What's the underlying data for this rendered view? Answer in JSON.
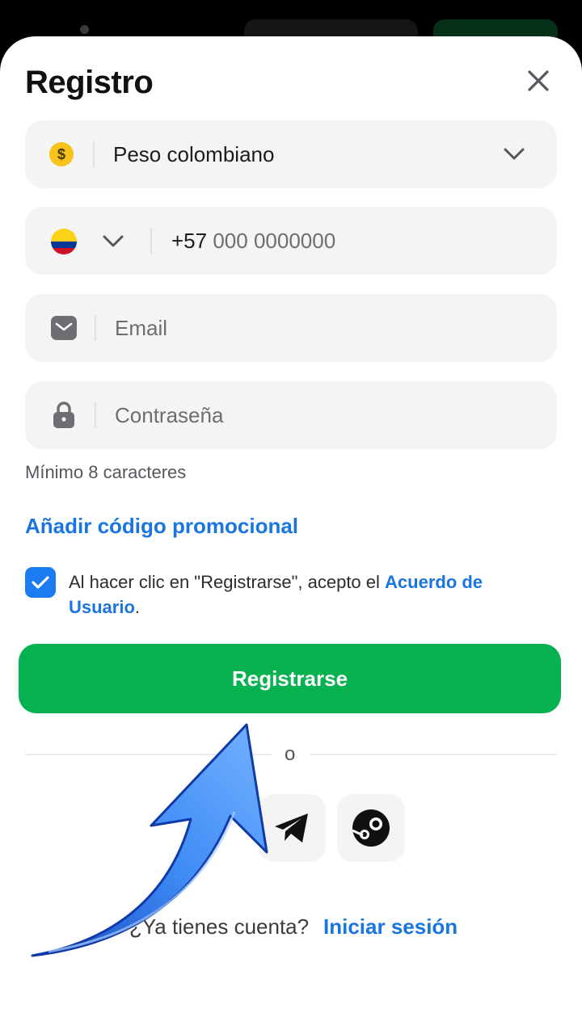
{
  "header": {
    "title": "Registro"
  },
  "currency": {
    "symbol": "$",
    "label": "Peso colombiano"
  },
  "phone": {
    "prefix": "+57",
    "placeholder": "000 0000000",
    "country_flag": "colombia-flag-icon"
  },
  "email": {
    "placeholder": "Email"
  },
  "password": {
    "placeholder": "Contraseña",
    "hint": "Mínimo 8 caracteres"
  },
  "promo": {
    "label": "Añadir código promocional"
  },
  "terms": {
    "checked": true,
    "text": "Al hacer clic en \"Registrarse\", acepto el ",
    "link": "Acuerdo de Usuario",
    "suffix": "."
  },
  "register_button": {
    "label": "Registrarse"
  },
  "divider": {
    "label": "o"
  },
  "social": [
    "telegram-icon",
    "steam-icon"
  ],
  "login": {
    "question": "¿Ya tienes cuenta?",
    "link": "Iniciar sesión"
  },
  "colors": {
    "primary_green": "#06b24f",
    "link_blue": "#1a75e0",
    "arrow_blue": "#2d7cf2"
  }
}
